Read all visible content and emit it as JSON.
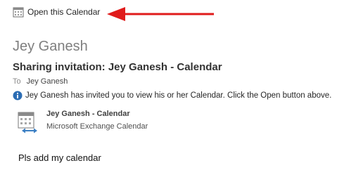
{
  "toolbar": {
    "open_calendar_label": "Open this Calendar"
  },
  "message": {
    "sender_name": "Jey Ganesh",
    "subject": "Sharing invitation: Jey Ganesh - Calendar",
    "to_label": "To",
    "to_value": "Jey Ganesh",
    "info_text": "Jey Ganesh has invited you to view his or her Calendar.  Click the Open button above.",
    "calendar_title": "Jey Ganesh - Calendar",
    "calendar_subtitle": "Microsoft Exchange Calendar",
    "body": "Pls add my calendar"
  },
  "colors": {
    "annotation_arrow": "#e01b1b",
    "info_icon": "#2b6cb3",
    "share_arrow": "#3b7fc4"
  },
  "icons": {
    "toolbar": "calendar-icon",
    "info": "info-icon",
    "attachment": "shared-calendar-icon"
  }
}
